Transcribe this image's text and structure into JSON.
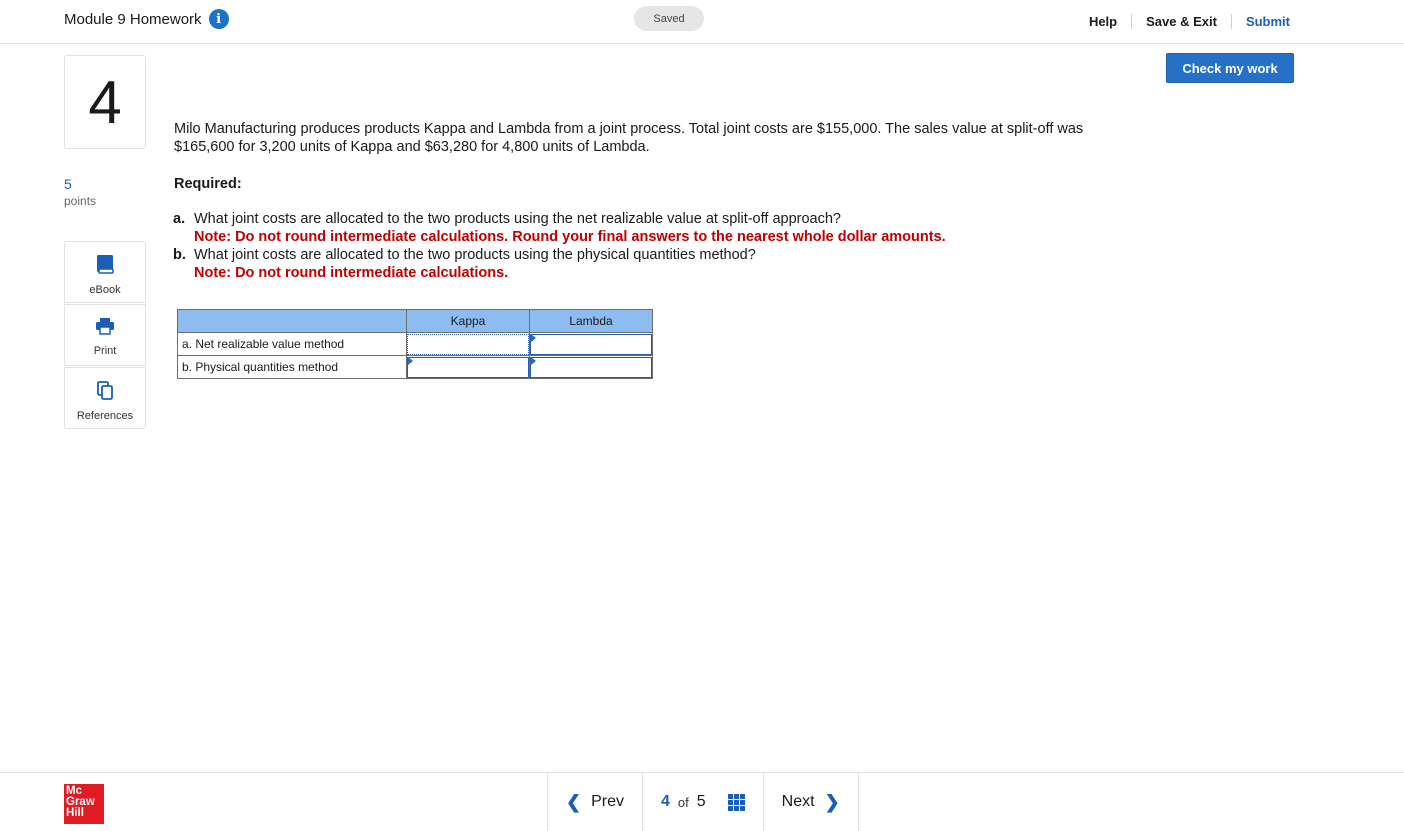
{
  "header": {
    "module_title": "Module 9 Homework",
    "saved_label": "Saved",
    "help_label": "Help",
    "save_exit_label": "Save & Exit",
    "submit_label": "Submit"
  },
  "check_work_label": "Check my work",
  "question": {
    "number": "4",
    "points_value": "5",
    "points_label": "points",
    "text": "Milo Manufacturing produces products Kappa and Lambda from a joint process. Total joint costs are $155,000. The sales value at split-off was $165,600 for 3,200 units of Kappa and $63,280 for 4,800 units of Lambda.",
    "required_label": "Required:",
    "items": [
      {
        "letter": "a.",
        "text": "What joint costs are allocated to the two products using the net realizable value at split-off approach?",
        "note": "Note: Do not round intermediate calculations. Round your final answers to the nearest whole dollar amounts."
      },
      {
        "letter": "b.",
        "text": "What joint costs are allocated to the two products using the physical quantities method?",
        "note": "Note: Do not round intermediate calculations."
      }
    ]
  },
  "tools": {
    "ebook_label": "eBook",
    "print_label": "Print",
    "references_label": "References"
  },
  "table": {
    "headers": [
      "",
      "Kappa",
      "Lambda"
    ],
    "rows": [
      {
        "label": "a. Net realizable value method",
        "kappa": "",
        "lambda": ""
      },
      {
        "label": "b. Physical quantities method",
        "kappa": "",
        "lambda": ""
      }
    ]
  },
  "footer": {
    "logo_lines": [
      "Mc",
      "Graw",
      "Hill"
    ],
    "prev_label": "Prev",
    "current_page": "4",
    "of_label": "of",
    "total_pages": "5",
    "next_label": "Next"
  },
  "colors": {
    "accent": "#1a5fb4",
    "button": "#2670c8",
    "note_red": "#c00000",
    "table_header": "#8cbcf0",
    "logo_red": "#e21a23"
  }
}
